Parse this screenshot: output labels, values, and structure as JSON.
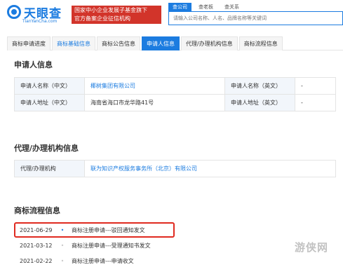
{
  "header": {
    "logo_text": "天眼查",
    "logo_domain": "TianYanCha.com",
    "badge_line1": "国家中小企业发展子基金旗下",
    "badge_line2": "官方备案企业征信机构",
    "search_tabs": [
      "查公司",
      "查老板",
      "查关系"
    ],
    "search_placeholder": "请输入公司名称、人名、品牌名称等关键词"
  },
  "nav": {
    "tabs": [
      "商标申请进度",
      "商标基础信息",
      "商标公告信息",
      "申请人信息",
      "代理/办理机构信息",
      "商标流程信息"
    ]
  },
  "applicant": {
    "title": "申请人信息",
    "name_cn_label": "申请人名称（中文）",
    "name_cn_value": "椰树集团有限公司",
    "name_en_label": "申请人名称（英文）",
    "name_en_value": "-",
    "addr_cn_label": "申请人地址（中文）",
    "addr_cn_value": "海南省海口市龙华路41号",
    "addr_en_label": "申请人地址（英文）",
    "addr_en_value": "-"
  },
  "agency": {
    "title": "代理/办理机构信息",
    "label": "代理/办理机构",
    "value": "联为知识产权服务事务所（北京）有限公司"
  },
  "flow": {
    "title": "商标流程信息",
    "items": [
      {
        "date": "2021-06-29",
        "text": "商标注册申请---驳回通知发文"
      },
      {
        "date": "2021-03-12",
        "text": "商标注册申请---受理通知书发文"
      },
      {
        "date": "2021-02-22",
        "text": "商标注册申请---申请收文"
      }
    ]
  },
  "watermark": "游侠网",
  "colors": {
    "brand_blue": "#1c7ce0",
    "badge_red": "#d2342a",
    "highlight_red": "#e02a20"
  }
}
